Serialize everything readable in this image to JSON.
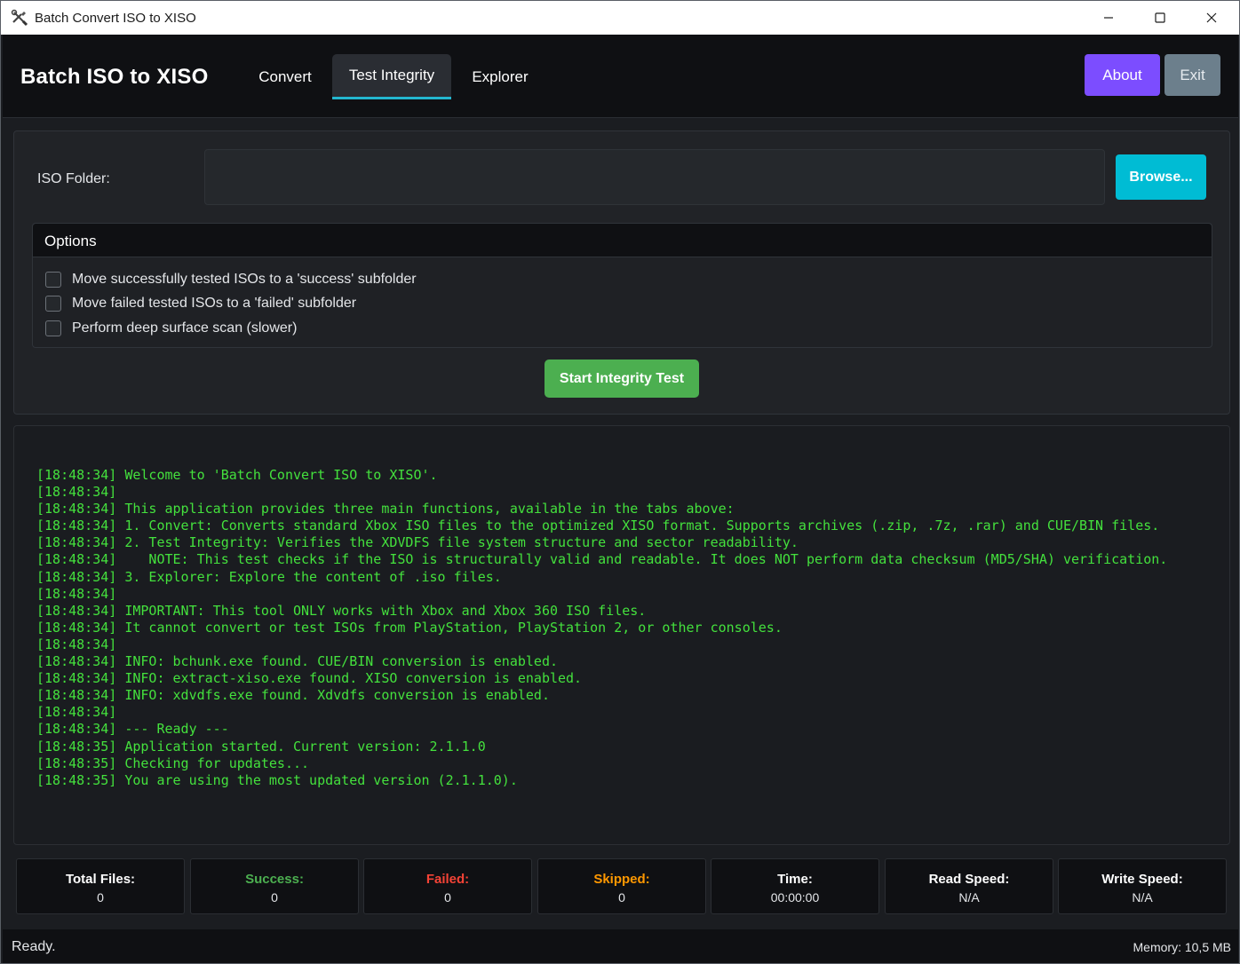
{
  "window": {
    "title": "Batch Convert ISO to XISO"
  },
  "header": {
    "app_title": "Batch ISO to XISO",
    "tabs": [
      {
        "label": "Convert",
        "active": false
      },
      {
        "label": "Test Integrity",
        "active": true
      },
      {
        "label": "Explorer",
        "active": false
      }
    ],
    "about_label": "About",
    "exit_label": "Exit"
  },
  "form": {
    "folder_label": "ISO Folder:",
    "folder_value": "",
    "browse_label": "Browse..."
  },
  "options": {
    "title": "Options",
    "items": [
      {
        "label": "Move successfully tested ISOs to a 'success' subfolder",
        "checked": false
      },
      {
        "label": "Move failed tested ISOs to a 'failed' subfolder",
        "checked": false
      },
      {
        "label": "Perform deep surface scan (slower)",
        "checked": false
      }
    ]
  },
  "start_label": "Start Integrity Test",
  "log": {
    "lines": [
      "[18:48:34] Welcome to 'Batch Convert ISO to XISO'.",
      "[18:48:34]",
      "[18:48:34] This application provides three main functions, available in the tabs above:",
      "[18:48:34] 1. Convert: Converts standard Xbox ISO files to the optimized XISO format. Supports archives (.zip, .7z, .rar) and CUE/BIN files.",
      "[18:48:34] 2. Test Integrity: Verifies the XDVDFS file system structure and sector readability.",
      "[18:48:34]    NOTE: This test checks if the ISO is structurally valid and readable. It does NOT perform data checksum (MD5/SHA) verification.",
      "[18:48:34] 3. Explorer: Explore the content of .iso files.",
      "[18:48:34]",
      "[18:48:34] IMPORTANT: This tool ONLY works with Xbox and Xbox 360 ISO files.",
      "[18:48:34] It cannot convert or test ISOs from PlayStation, PlayStation 2, or other consoles.",
      "[18:48:34]",
      "[18:48:34] INFO: bchunk.exe found. CUE/BIN conversion is enabled.",
      "[18:48:34] INFO: extract-xiso.exe found. XISO conversion is enabled.",
      "[18:48:34] INFO: xdvdfs.exe found. Xdvdfs conversion is enabled.",
      "[18:48:34]",
      "[18:48:34] --- Ready ---",
      "[18:48:35] Application started. Current version: 2.1.1.0",
      "[18:48:35] Checking for updates...",
      "[18:48:35] You are using the most updated version (2.1.1.0)."
    ],
    "text_color": "#44e13d"
  },
  "stats": [
    {
      "label": "Total Files:",
      "value": "0",
      "color": "#ffffff"
    },
    {
      "label": "Success:",
      "value": "0",
      "color": "#4caf50"
    },
    {
      "label": "Failed:",
      "value": "0",
      "color": "#f44336"
    },
    {
      "label": "Skipped:",
      "value": "0",
      "color": "#ff9800"
    },
    {
      "label": "Time:",
      "value": "00:00:00",
      "color": "#ffffff"
    },
    {
      "label": "Read Speed:",
      "value": "N/A",
      "color": "#ffffff"
    },
    {
      "label": "Write Speed:",
      "value": "N/A",
      "color": "#ffffff"
    }
  ],
  "statusbar": {
    "status": "Ready.",
    "memory": "Memory: 10,5 MB"
  },
  "colors": {
    "accent_tab": "#23b6cf",
    "about": "#7c4dff",
    "exit": "#6c7f8c",
    "browse": "#00bcd4",
    "start": "#4caf50"
  }
}
